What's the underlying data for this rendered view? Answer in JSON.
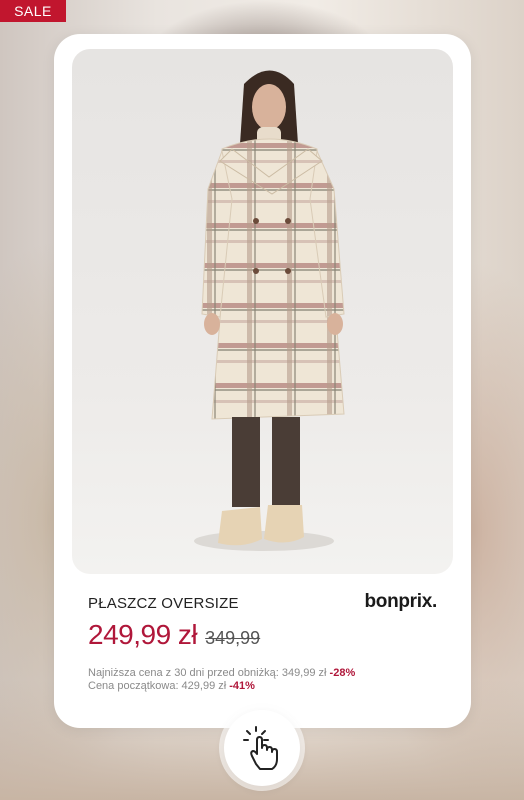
{
  "badge": {
    "label": "SALE"
  },
  "product": {
    "name": "PŁASZCZ OVERSIZE",
    "brand": "bonprix.",
    "price": "249,99 zł",
    "old_price": "349,99",
    "lowest_price_text": "Najniższa cena z 30 dni  przed obniżką: 349,99 zł ",
    "lowest_price_discount": "-28%",
    "initial_price_text": "Cena początkowa: 429,99 zł ",
    "initial_price_discount": "-41%"
  },
  "icons": {
    "tap": "hand-tap-icon"
  },
  "colors": {
    "accent": "#b0173a",
    "badge": "#c1162e"
  }
}
